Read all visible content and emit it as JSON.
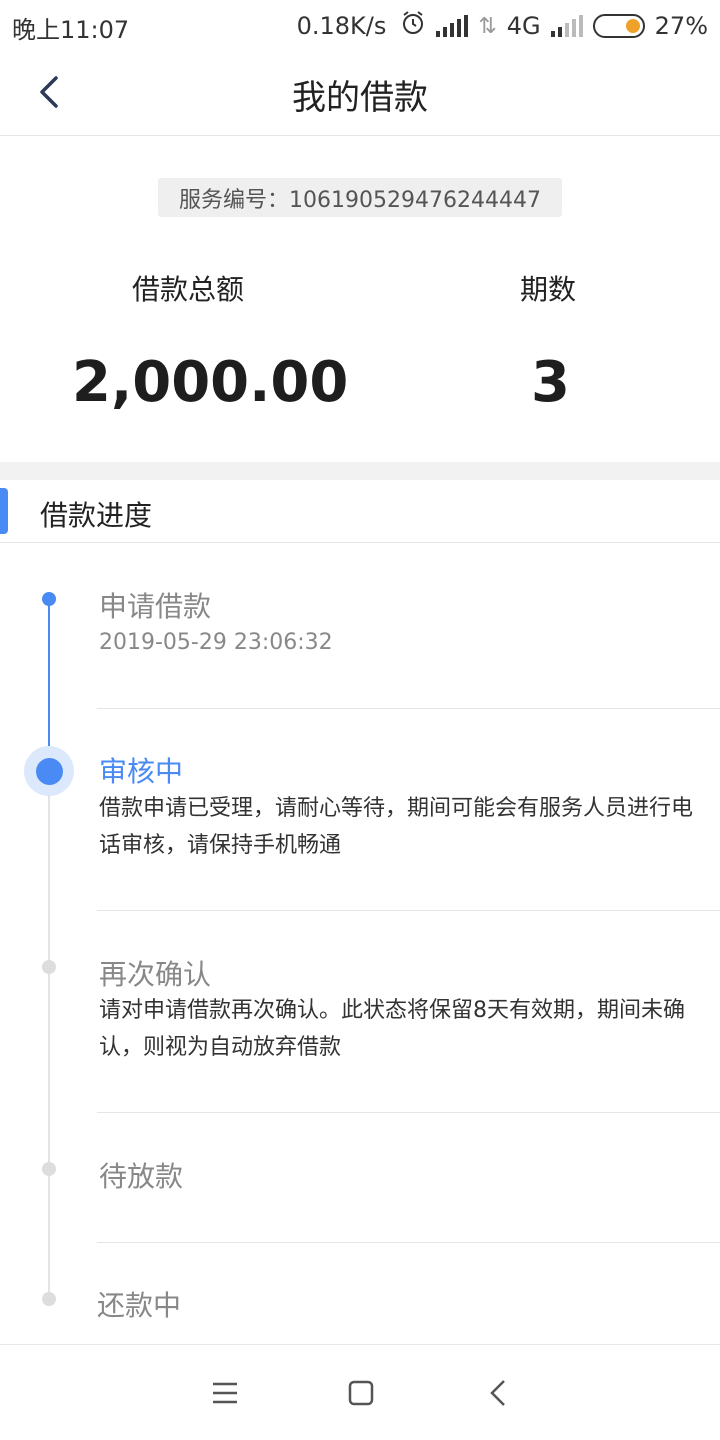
{
  "status_bar": {
    "time": "晚上11:07",
    "net_speed": "0.18K/s",
    "network": "4G",
    "battery": "27%",
    "icons": [
      "alarm-icon",
      "signal-icon",
      "data-arrows-icon",
      "signal-icon",
      "battery-icon"
    ]
  },
  "header": {
    "title": "我的借款",
    "back_icon": "chevron-left-icon"
  },
  "summary": {
    "service_no": "服务编号：106190529476244447",
    "amount_label": "借款总额",
    "amount_value": "2,000.00",
    "periods_label": "期数",
    "periods_value": "3"
  },
  "progress": {
    "title": "借款进度",
    "steps": [
      {
        "title": "申请借款",
        "detail": "2019-05-29 23:06:32",
        "state": "done"
      },
      {
        "title": "审核中",
        "detail": "借款申请已受理，请耐心等待，期间可能会有服务人员进行电话审核，请保持手机畅通",
        "state": "current"
      },
      {
        "title": "再次确认",
        "detail": "请对申请借款再次确认。此状态将保留8天有效期，期间未确认，则视为自动放弃借款",
        "state": "pending"
      },
      {
        "title": "待放款",
        "detail": "",
        "state": "pending"
      },
      {
        "title": "还款中",
        "detail": "",
        "state": "pending"
      }
    ]
  },
  "nav": {
    "icons": [
      "menu-icon",
      "home-square-icon",
      "back-triangle-icon"
    ]
  },
  "colors": {
    "accent": "#4a8af4",
    "inactive_dot": "#dddddd",
    "muted_text": "#888888",
    "battery_fill": "#f0a12a"
  }
}
